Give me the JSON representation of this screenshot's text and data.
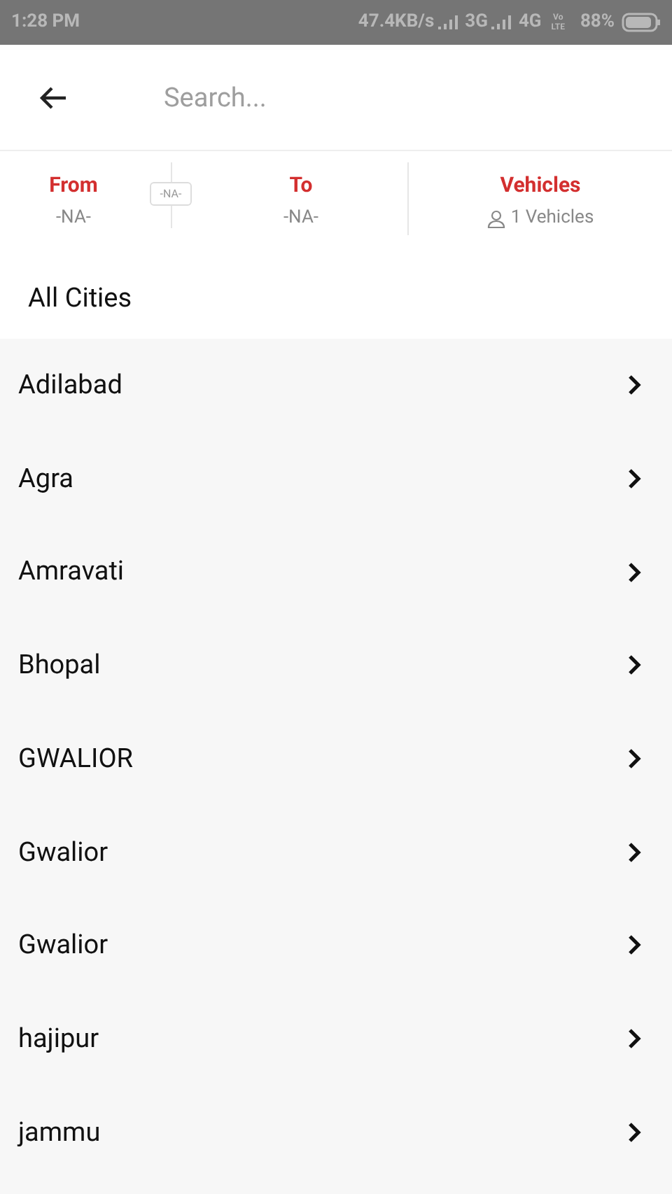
{
  "status_bar": {
    "time": "1:28 PM",
    "speed": "47.4KB/s",
    "network_1": "3G",
    "network_2": "4G",
    "volte_top": "Vo",
    "volte_bottom": "LTE",
    "battery": "88%"
  },
  "search": {
    "placeholder": "Search..."
  },
  "summary": {
    "from": {
      "label": "From",
      "value": "-NA-"
    },
    "middle_badge": "-NA-",
    "to": {
      "label": "To",
      "value": "-NA-"
    },
    "vehicles": {
      "label": "Vehicles",
      "value": "1 Vehicles"
    }
  },
  "section_title": "All Cities",
  "cities": [
    {
      "name": "Adilabad"
    },
    {
      "name": "Agra"
    },
    {
      "name": "Amravati"
    },
    {
      "name": "Bhopal"
    },
    {
      "name": "GWALIOR"
    },
    {
      "name": "Gwalior"
    },
    {
      "name": "Gwalior"
    },
    {
      "name": "hajipur"
    },
    {
      "name": "jammu"
    }
  ]
}
